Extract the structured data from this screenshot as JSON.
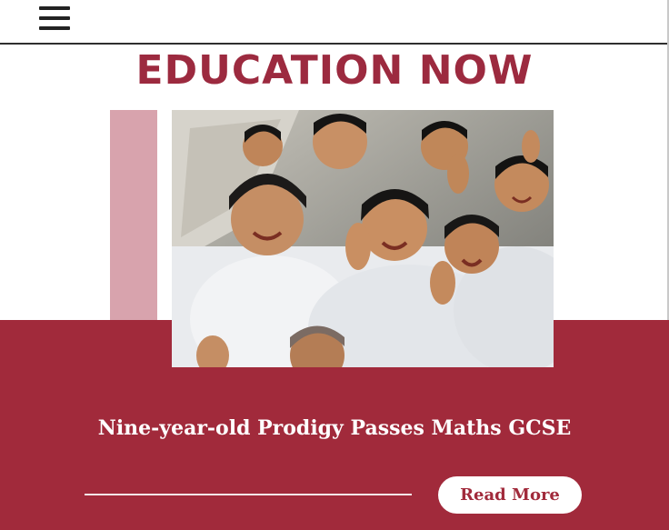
{
  "header": {
    "menu_icon": "hamburger-menu-icon"
  },
  "site": {
    "title": "EDUCATION NOW"
  },
  "hero": {
    "image_alt": "Group of smiling schoolchildren in white uniforms waving at the camera",
    "headline": "Nine-year-old Prodigy Passes Maths GCSE",
    "read_more_label": "Read More"
  },
  "colors": {
    "brand_red": "#a12a3b",
    "title_red": "#9c2a3f",
    "accent_pink": "#d8a3ad",
    "header_rule": "#2f2f2f"
  }
}
